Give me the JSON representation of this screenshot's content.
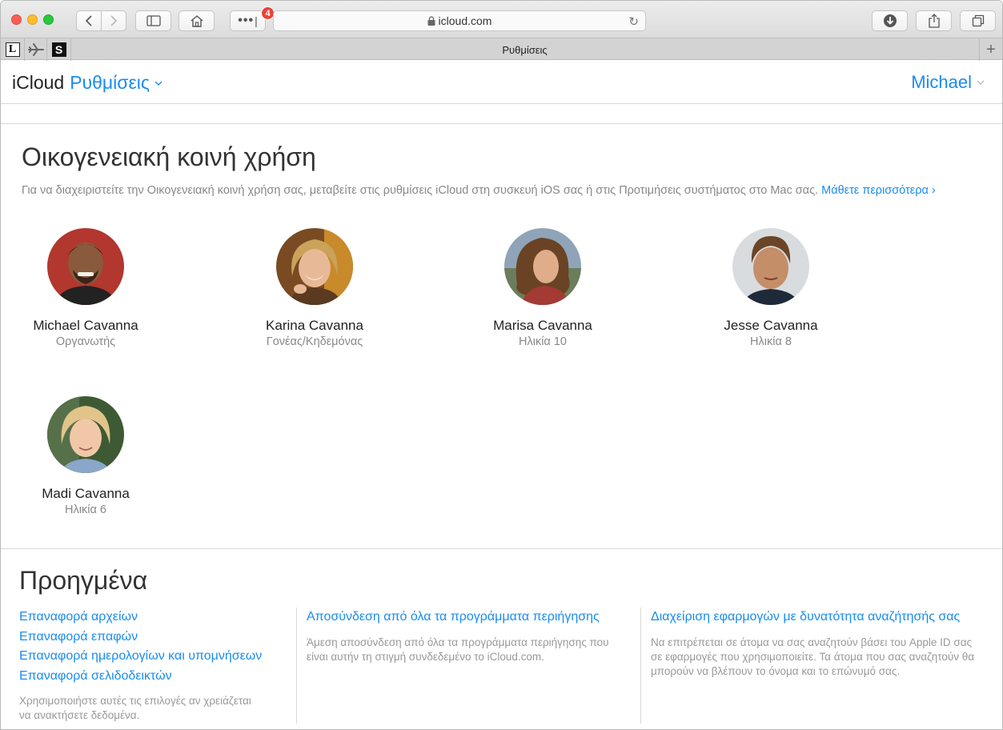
{
  "browser": {
    "url": "icloud.com",
    "badge_count": "4",
    "tab_title": "Ρυθμίσεις",
    "pinned": [
      {
        "name": "L",
        "style": "l"
      },
      {
        "name": "plane",
        "style": "plane"
      },
      {
        "name": "S",
        "style": "s"
      }
    ]
  },
  "header": {
    "brand": "iCloud",
    "app": "Ρυθμίσεις",
    "user": "Michael"
  },
  "family": {
    "title": "Οικογενειακή κοινή χρήση",
    "description": "Για να διαχειριστείτε την Οικογενειακή κοινή χρήση σας, μεταβείτε στις ρυθμίσεις iCloud στη συσκευή iOS σας ή στις Προτιμήσεις συστήματος στο Mac σας.",
    "learn_more": "Μάθετε περισσότερα",
    "members": [
      {
        "name": "Michael Cavanna",
        "role": "Οργανωτής"
      },
      {
        "name": "Karina Cavanna",
        "role": "Γονέας/Κηδεμόνας"
      },
      {
        "name": "Marisa Cavanna",
        "role": "Ηλικία 10"
      },
      {
        "name": "Jesse Cavanna",
        "role": "Ηλικία 8"
      },
      {
        "name": "Madi Cavanna",
        "role": "Ηλικία 6"
      }
    ]
  },
  "advanced": {
    "title": "Προηγμένα",
    "restore_links": [
      "Επαναφορά αρχείων",
      "Επαναφορά επαφών",
      "Επαναφορά ημερολογίων και υπομνήσεων",
      "Επαναφορά σελιδοδεικτών"
    ],
    "restore_note": "Χρησιμοποιήστε αυτές τις επιλογές αν χρειάζεται να ανακτήσετε δεδομένα.",
    "signout_link": "Αποσύνδεση από όλα τα προγράμματα περιήγησης",
    "signout_note": "Άμεση αποσύνδεση από όλα τα προγράμματα περιήγησης που είναι αυτήν τη στιγμή συνδεδεμένο το iCloud.com.",
    "manage_link": "Διαχείριση εφαρμογών με δυνατότητα αναζήτησής σας",
    "manage_note": "Να επιτρέπεται σε άτομα να σας αναζητούν βάσει του Apple ID σας σε εφαρμογές που χρησιμοποιείτε. Τα άτομα που σας αναζητούν θα μπορούν να βλέπουν το όνομα και το επώνυμό σας."
  }
}
